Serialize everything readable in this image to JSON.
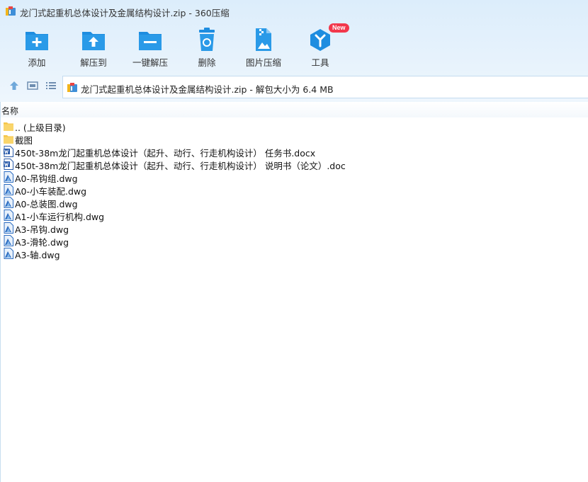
{
  "window": {
    "title": "龙门式起重机总体设计及金属结构设计.zip - 360压缩"
  },
  "toolbar": {
    "add_label": "添加",
    "extract_to_label": "解压到",
    "one_click_extract_label": "一键解压",
    "delete_label": "删除",
    "image_compress_label": "图片压缩",
    "tools_label": "工具",
    "tools_badge": "New"
  },
  "address": {
    "text": "龙门式起重机总体设计及金属结构设计.zip - 解包大小为 6.4 MB"
  },
  "list": {
    "column_name": "名称",
    "items": [
      {
        "name": ".. (上级目录)",
        "icon": "folder-icon"
      },
      {
        "name": "截图",
        "icon": "folder-icon"
      },
      {
        "name": "450t-38m龙门起重机总体设计（起升、动行、行走机构设计） 任务书.docx",
        "icon": "word-document-icon"
      },
      {
        "name": "450t-38m龙门起重机总体设计（起升、动行、行走机构设计） 说明书（论文）.doc",
        "icon": "word-document-icon"
      },
      {
        "name": "A0-吊钩组.dwg",
        "icon": "dwg-file-icon"
      },
      {
        "name": "A0-小车装配.dwg",
        "icon": "dwg-file-icon"
      },
      {
        "name": "A0-总装图.dwg",
        "icon": "dwg-file-icon"
      },
      {
        "name": "A1-小车运行机构.dwg",
        "icon": "dwg-file-icon"
      },
      {
        "name": "A3-吊钩.dwg",
        "icon": "dwg-file-icon"
      },
      {
        "name": "A3-滑轮.dwg",
        "icon": "dwg-file-icon"
      },
      {
        "name": "A3-轴.dwg",
        "icon": "dwg-file-icon"
      }
    ]
  },
  "colors": {
    "accent": "#1e8de0",
    "badge": "#f2374b",
    "toolbar_bg": "#e3f0fb"
  }
}
